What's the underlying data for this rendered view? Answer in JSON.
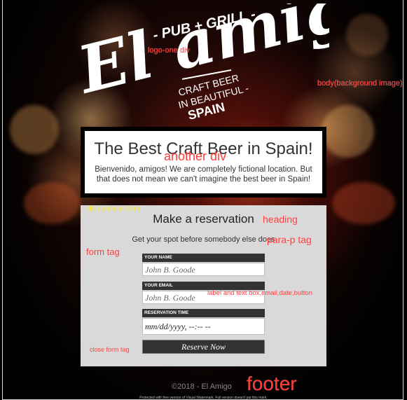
{
  "logo": {
    "pub_grill": "- PUB + GRILL -",
    "name": "El amigo",
    "craft": "CRAFT BEER",
    "in_beautiful": "IN BEAUTIFUL -",
    "spain": "SPAIN"
  },
  "hero": {
    "title": "The Best Craft Beer in Spain!",
    "text": "Bienvenido, amigos! We are completely fictional location. But that does not mean we can't imagine the best beer in Spain!"
  },
  "reservation": {
    "heading": "Make a reservation",
    "subtext": "Get your spot before somebody else does",
    "fields": [
      {
        "label": "YOUR NAME",
        "value": "John B. Goode"
      },
      {
        "label": "YOUR EMAIL",
        "value": "John B. Goode"
      },
      {
        "label": "RESERVATION TIME",
        "value": "mm/dd/yyyy, --:-- --"
      }
    ],
    "button": "Reserve Now"
  },
  "footer": {
    "copyright": "©2018 - El Amigo",
    "watermark": "Protected with free version of Visual Watermark. Full version doesn't put this mark."
  },
  "annotations": {
    "logo_div": "logo-one div",
    "body_bg": "body(background image)",
    "another_div": "another div",
    "div_contains_form": "div contains form",
    "heading": "heading",
    "para_tag": "para-p tag",
    "form_tag": "form tag",
    "label_box": "label and text box,email,date,button",
    "close_form": "close form tag",
    "footer": "footer"
  },
  "colors": {
    "annotation": "#ff3b3b",
    "yellow_annotation": "#f0e040",
    "panel": "#d9d9d9",
    "label_bg": "#333333"
  }
}
